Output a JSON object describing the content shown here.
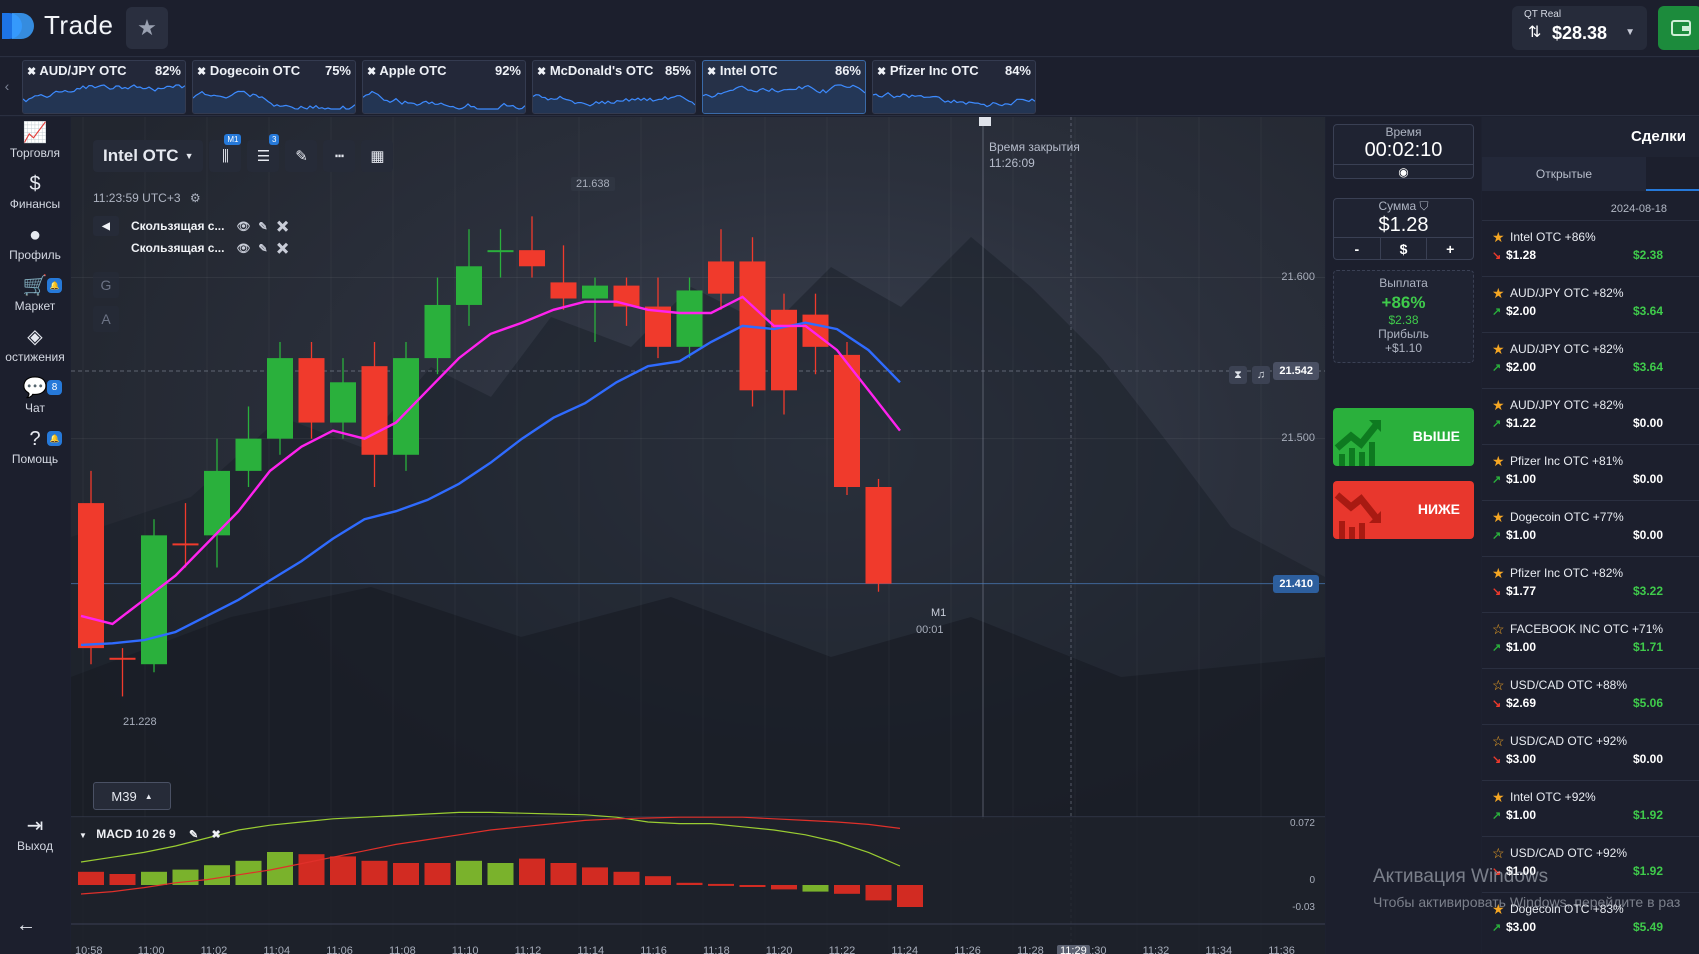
{
  "header": {
    "logo_text": "Trade",
    "account_label": "QT Real",
    "balance": "$28.38"
  },
  "asset_tabs": [
    {
      "name": "AUD/JPY OTC",
      "payout": "82%",
      "active": false
    },
    {
      "name": "Dogecoin OTC",
      "payout": "75%",
      "active": false
    },
    {
      "name": "Apple OTC",
      "payout": "92%",
      "active": false
    },
    {
      "name": "McDonald's OTC",
      "payout": "85%",
      "active": false
    },
    {
      "name": "Intel OTC",
      "payout": "86%",
      "active": true
    },
    {
      "name": "Pfizer Inc OTC",
      "payout": "84%",
      "active": false
    }
  ],
  "sidebar": {
    "items": [
      {
        "label": "Торговля",
        "icon": "chart-line-icon"
      },
      {
        "label": "Финансы",
        "icon": "dollar-icon"
      },
      {
        "label": "Профиль",
        "icon": "user-icon"
      },
      {
        "label": "Маркет",
        "icon": "cart-icon",
        "badge": ""
      },
      {
        "label": "остижения",
        "icon": "diamond-icon"
      },
      {
        "label": "Чат",
        "icon": "chat-icon",
        "badge": "8"
      },
      {
        "label": "Помощь",
        "icon": "help-icon",
        "badge": ""
      }
    ],
    "logout_label": "Выход"
  },
  "chart": {
    "asset": "Intel OTC",
    "timeframe_badge": "M1",
    "indicators_badge": "3",
    "server_time": "11:23:59 UTC+3",
    "indicator_1": "Скользящая с...",
    "indicator_2": "Скользящая с...",
    "tool_g": "G",
    "tool_a": "A",
    "close_time_label": "Время закрытия",
    "close_time": "11:26:09",
    "high_label": "21.638",
    "low_label": "21.228",
    "timeframe_button": "M39",
    "current_tf": "M1",
    "countdown": "00:01",
    "macd_label": "MACD 10 26 9",
    "colors": {
      "up": "#2ab03c",
      "down": "#f03a2c",
      "ma_fast": "#ff22ee",
      "ma_slow": "#2f6bff",
      "macd_line": "#9acd32",
      "signal_line": "#e0302a"
    }
  },
  "chart_data": {
    "type": "candlestick",
    "y_ticks": [
      "21.600",
      "21.500"
    ],
    "price_levels": [
      "21.542",
      "21.410"
    ],
    "macd_ticks": [
      "0.072",
      "0",
      "-0.03"
    ],
    "time_ticks": [
      "10:58",
      "11:00",
      "11:02",
      "11:04",
      "11:06",
      "11:08",
      "11:10",
      "11:12",
      "11:14",
      "11:16",
      "11:18",
      "11:20",
      "11:22",
      "11:24",
      "11:26",
      "11:28",
      "11:30",
      "11:32",
      "11:34",
      "11:36"
    ],
    "active_time_tick": "11:29",
    "candles": [
      {
        "o": 21.46,
        "c": 21.37,
        "h": 21.48,
        "l": 21.36
      },
      {
        "o": 21.364,
        "c": 21.364,
        "h": 21.37,
        "l": 21.34
      },
      {
        "o": 21.36,
        "c": 21.44,
        "h": 21.45,
        "l": 21.355
      },
      {
        "o": 21.435,
        "c": 21.435,
        "h": 21.46,
        "l": 21.42
      },
      {
        "o": 21.44,
        "c": 21.48,
        "h": 21.5,
        "l": 21.42
      },
      {
        "o": 21.48,
        "c": 21.5,
        "h": 21.52,
        "l": 21.47
      },
      {
        "o": 21.5,
        "c": 21.55,
        "h": 21.56,
        "l": 21.49
      },
      {
        "o": 21.55,
        "c": 21.51,
        "h": 21.56,
        "l": 21.5
      },
      {
        "o": 21.51,
        "c": 21.535,
        "h": 21.55,
        "l": 21.5
      },
      {
        "o": 21.545,
        "c": 21.49,
        "h": 21.56,
        "l": 21.47
      },
      {
        "o": 21.49,
        "c": 21.55,
        "h": 21.56,
        "l": 21.48
      },
      {
        "o": 21.55,
        "c": 21.583,
        "h": 21.6,
        "l": 21.54
      },
      {
        "o": 21.583,
        "c": 21.607,
        "h": 21.63,
        "l": 21.57
      },
      {
        "o": 21.617,
        "c": 21.617,
        "h": 21.63,
        "l": 21.6
      },
      {
        "o": 21.617,
        "c": 21.607,
        "h": 21.638,
        "l": 21.6
      },
      {
        "o": 21.597,
        "c": 21.587,
        "h": 21.62,
        "l": 21.58
      },
      {
        "o": 21.587,
        "c": 21.595,
        "h": 21.6,
        "l": 21.56
      },
      {
        "o": 21.595,
        "c": 21.582,
        "h": 21.6,
        "l": 21.57
      },
      {
        "o": 21.582,
        "c": 21.557,
        "h": 21.6,
        "l": 21.55
      },
      {
        "o": 21.557,
        "c": 21.592,
        "h": 21.6,
        "l": 21.55
      },
      {
        "o": 21.61,
        "c": 21.59,
        "h": 21.63,
        "l": 21.58
      },
      {
        "o": 21.61,
        "c": 21.53,
        "h": 21.625,
        "l": 21.52
      },
      {
        "o": 21.58,
        "c": 21.53,
        "h": 21.59,
        "l": 21.515
      },
      {
        "o": 21.577,
        "c": 21.557,
        "h": 21.59,
        "l": 21.54
      },
      {
        "o": 21.552,
        "c": 21.47,
        "h": 21.56,
        "l": 21.465
      },
      {
        "o": 21.47,
        "c": 21.41,
        "h": 21.475,
        "l": 21.405
      }
    ],
    "ma_fast": [
      21.39,
      21.385,
      21.4,
      21.415,
      21.435,
      21.455,
      21.48,
      21.495,
      21.505,
      21.5,
      21.51,
      21.53,
      21.55,
      21.565,
      21.572,
      21.58,
      21.585,
      21.585,
      21.58,
      21.578,
      21.578,
      21.588,
      21.57,
      21.57,
      21.555,
      21.53,
      21.505
    ],
    "ma_slow": [
      21.372,
      21.373,
      21.375,
      21.38,
      21.39,
      21.4,
      21.412,
      21.424,
      21.438,
      21.45,
      21.455,
      21.462,
      21.472,
      21.485,
      21.5,
      21.513,
      21.522,
      21.535,
      21.545,
      21.548,
      21.56,
      21.57,
      21.568,
      21.572,
      21.568,
      21.555,
      21.535
    ],
    "macd_hist": [
      -0.012,
      -0.01,
      -0.012,
      -0.014,
      -0.018,
      -0.022,
      -0.03,
      -0.028,
      -0.026,
      -0.022,
      -0.02,
      -0.02,
      -0.022,
      -0.02,
      -0.024,
      -0.02,
      -0.016,
      -0.012,
      -0.008,
      -0.002,
      -0.001,
      0,
      0.004,
      0.006,
      0.008,
      0.014,
      0.02
    ],
    "macd_hist_color": [
      "down",
      "down",
      "up",
      "up",
      "up",
      "up",
      "up",
      "down",
      "down",
      "down",
      "down",
      "down",
      "up",
      "up",
      "down",
      "down",
      "down",
      "down",
      "down",
      "down",
      "down",
      "down",
      "down",
      "up",
      "down",
      "down",
      "down"
    ],
    "macd_line": [
      0.01,
      0.016,
      0.022,
      0.03,
      0.04,
      0.05,
      0.056,
      0.06,
      0.064,
      0.066,
      0.068,
      0.07,
      0.072,
      0.072,
      0.071,
      0.07,
      0.069,
      0.066,
      0.06,
      0.058,
      0.058,
      0.054,
      0.05,
      0.044,
      0.035,
      0.022,
      0.005
    ],
    "signal_line": [
      -0.03,
      -0.027,
      -0.022,
      -0.016,
      -0.012,
      -0.006,
      0.0,
      0.008,
      0.016,
      0.024,
      0.032,
      0.038,
      0.044,
      0.05,
      0.054,
      0.058,
      0.062,
      0.064,
      0.065,
      0.066,
      0.066,
      0.066,
      0.064,
      0.062,
      0.06,
      0.057,
      0.052
    ]
  },
  "trade_panel": {
    "time_label": "Время",
    "time_value": "00:02:10",
    "amount_label": "Сумма",
    "amount_value": "$1.28",
    "minus": "-",
    "currency": "$",
    "plus": "+",
    "payout_label": "Выплата",
    "payout_pct": "+86%",
    "payout_amount": "$2.38",
    "profit_label": "Прибыль",
    "profit_amount": "+$1.10",
    "up_label": "ВЫШЕ",
    "down_label": "НИЖЕ"
  },
  "deals": {
    "title": "Сделки",
    "tab_open": "Открытые",
    "date": "2024-08-18",
    "items": [
      {
        "asset": "Intel OTC +86%",
        "stake": "$1.28",
        "result": "$2.38",
        "dir": "down",
        "fav": true
      },
      {
        "asset": "AUD/JPY OTC +82%",
        "stake": "$2.00",
        "result": "$3.64",
        "dir": "up",
        "fav": true
      },
      {
        "asset": "AUD/JPY OTC +82%",
        "stake": "$2.00",
        "result": "$3.64",
        "dir": "up",
        "fav": true
      },
      {
        "asset": "AUD/JPY OTC +82%",
        "stake": "$1.22",
        "result": "$0.00",
        "dir": "up",
        "fav": true
      },
      {
        "asset": "Pfizer Inc OTC +81%",
        "stake": "$1.00",
        "result": "$0.00",
        "dir": "up",
        "fav": true
      },
      {
        "asset": "Dogecoin OTC +77%",
        "stake": "$1.00",
        "result": "$0.00",
        "dir": "up",
        "fav": true
      },
      {
        "asset": "Pfizer Inc OTC +82%",
        "stake": "$1.77",
        "result": "$3.22",
        "dir": "down",
        "fav": true
      },
      {
        "asset": "FACEBOOK INC OTC +71%",
        "stake": "$1.00",
        "result": "$1.71",
        "dir": "up",
        "fav": false
      },
      {
        "asset": "USD/CAD OTC +88%",
        "stake": "$2.69",
        "result": "$5.06",
        "dir": "down",
        "fav": false
      },
      {
        "asset": "USD/CAD OTC +92%",
        "stake": "$3.00",
        "result": "$0.00",
        "dir": "down",
        "fav": false
      },
      {
        "asset": "Intel OTC +92%",
        "stake": "$1.00",
        "result": "$1.92",
        "dir": "up",
        "fav": true
      },
      {
        "asset": "USD/CAD OTC +92%",
        "stake": "$1.00",
        "result": "$1.92",
        "dir": "down",
        "fav": false
      },
      {
        "asset": "Dogecoin OTC +83%",
        "stake": "$3.00",
        "result": "$5.49",
        "dir": "up",
        "fav": true
      }
    ]
  },
  "watermark": {
    "line1": "Активация Windows",
    "line2": "Чтобы активировать Windows, перейдите в раз"
  }
}
